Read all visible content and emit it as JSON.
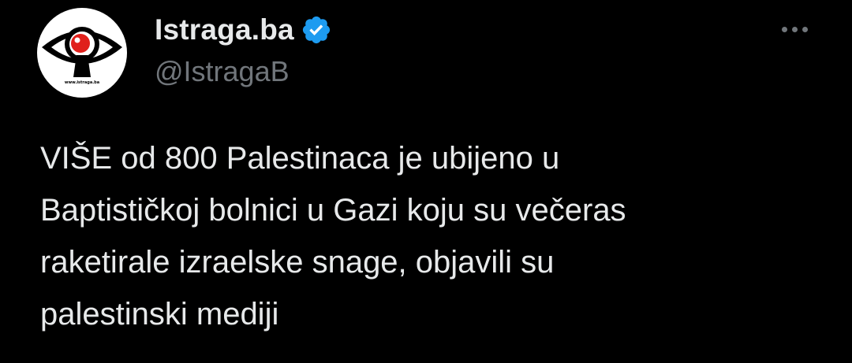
{
  "author": {
    "display_name": "Istraga.ba",
    "handle": "@IstragaB",
    "verified": true,
    "avatar_caption": "www.istraga.ba",
    "verified_color": "#1d9bf0",
    "avatar_accent_color": "#e0201b"
  },
  "more_menu": {
    "icon": "more-horizontal-icon"
  },
  "tweet": {
    "lines": [
      "VIŠE od 800 Palestinaca je ubijeno u",
      "Baptističkoj bolnici u Gazi koju su večeras",
      "raketirale izraelske snage, objavili su",
      "palestinski mediji"
    ]
  },
  "colors": {
    "background": "#000000",
    "primary_text": "#e7e9ea",
    "secondary_text": "#71767b"
  }
}
